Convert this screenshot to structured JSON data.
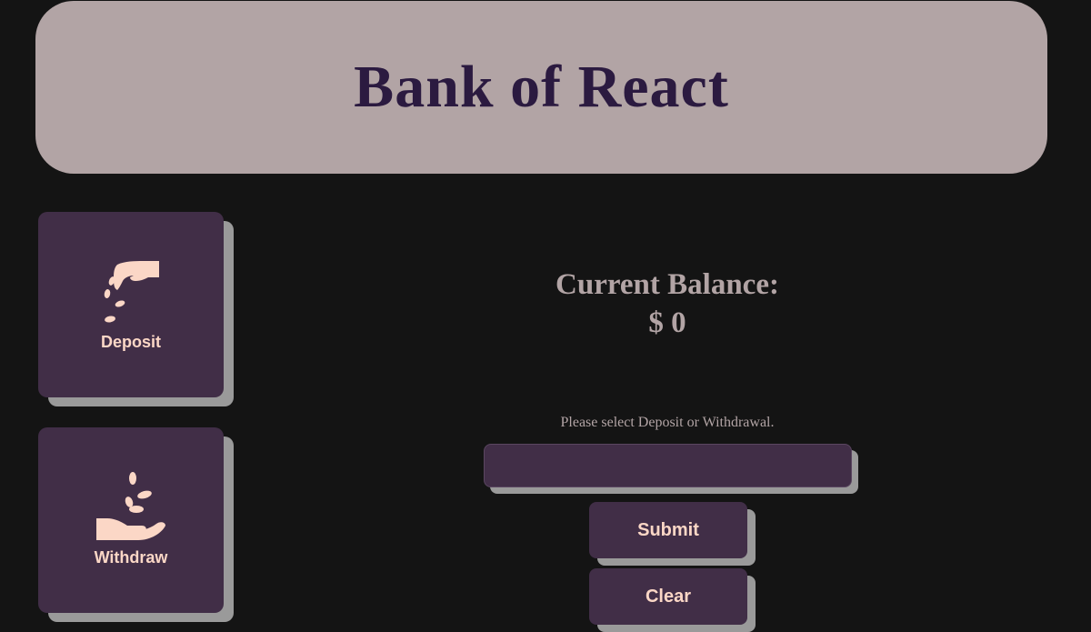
{
  "header": {
    "title": "Bank of React"
  },
  "actions": {
    "deposit": {
      "label": "Deposit",
      "icon": "coin-drop-hand-icon"
    },
    "withdraw": {
      "label": "Withdraw",
      "icon": "coin-receive-hand-icon"
    }
  },
  "balance": {
    "label": "Current Balance:",
    "value": "$ 0"
  },
  "form": {
    "prompt": "Please select Deposit or Withdrawal.",
    "amount_value": "",
    "amount_placeholder": "",
    "submit_label": "Submit",
    "clear_label": "Clear"
  },
  "colors": {
    "background": "#141414",
    "header_bg": "#b2a4a5",
    "title_text": "#2b1a40",
    "tile_bg": "#412e47",
    "accent_text": "#fbd7c6",
    "shadow": "#9a9a9a"
  }
}
